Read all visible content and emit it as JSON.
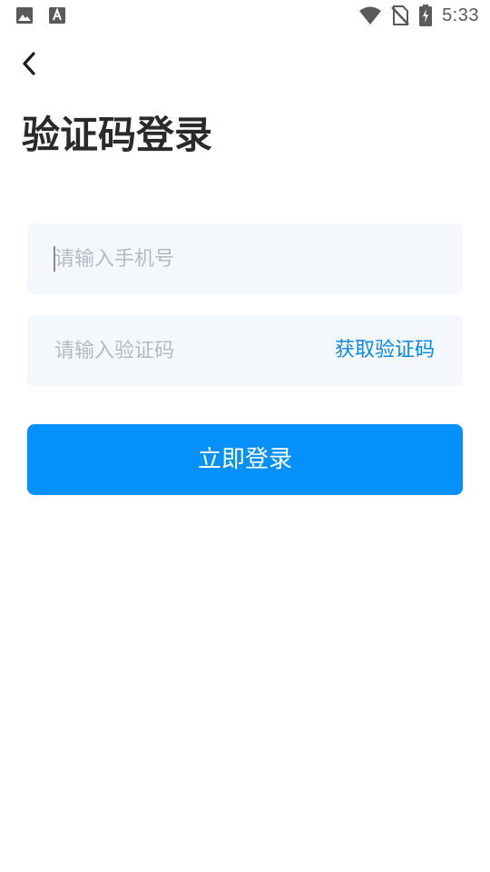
{
  "status_bar": {
    "left_icons": [
      "image-icon",
      "text-a-icon"
    ],
    "right_icons": [
      "wifi-icon",
      "no-sim-icon",
      "battery-charging-icon"
    ],
    "time": "5:33"
  },
  "header": {
    "back_icon": "chevron-left-icon"
  },
  "page": {
    "title": "验证码登录"
  },
  "form": {
    "phone_placeholder": "请输入手机号",
    "code_placeholder": "请输入验证码",
    "get_code_label": "获取验证码",
    "login_label": "立即登录"
  },
  "colors": {
    "accent": "#0590fb",
    "link": "#0b88e8",
    "field_bg": "#f4f8fd",
    "placeholder": "#b5b9c2",
    "title": "#2a2a2a"
  }
}
